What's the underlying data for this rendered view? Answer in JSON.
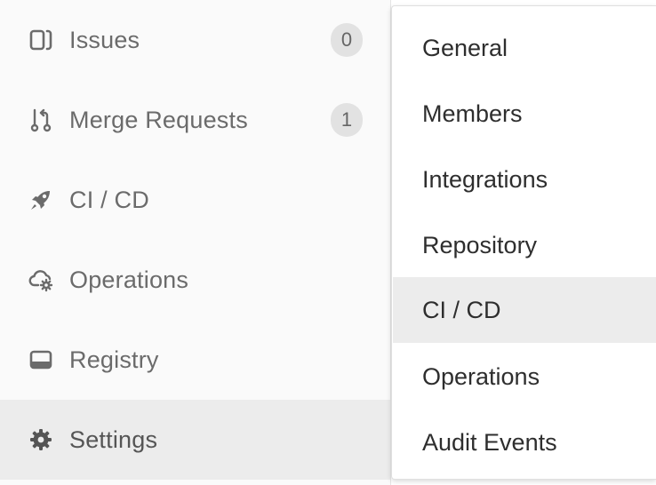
{
  "sidebar": {
    "items": [
      {
        "label": "Issues",
        "icon": "issues-icon",
        "badge": "0"
      },
      {
        "label": "Merge Requests",
        "icon": "merge-request-icon",
        "badge": "1"
      },
      {
        "label": "CI / CD",
        "icon": "rocket-icon"
      },
      {
        "label": "Operations",
        "icon": "cloud-gear-icon"
      },
      {
        "label": "Registry",
        "icon": "container-icon"
      },
      {
        "label": "Settings",
        "icon": "gear-icon",
        "active": true
      }
    ]
  },
  "flyout": {
    "items": [
      {
        "label": "General"
      },
      {
        "label": "Members"
      },
      {
        "label": "Integrations"
      },
      {
        "label": "Repository"
      },
      {
        "label": "CI / CD",
        "active": true
      },
      {
        "label": "Operations"
      },
      {
        "label": "Audit Events"
      }
    ]
  },
  "colors": {
    "sidebar_bg": "#fafafa",
    "active_bg": "#ececec",
    "label_text": "#6b6b6b",
    "flyout_text": "#2e2e2e",
    "badge_bg": "#e2e2e2"
  }
}
